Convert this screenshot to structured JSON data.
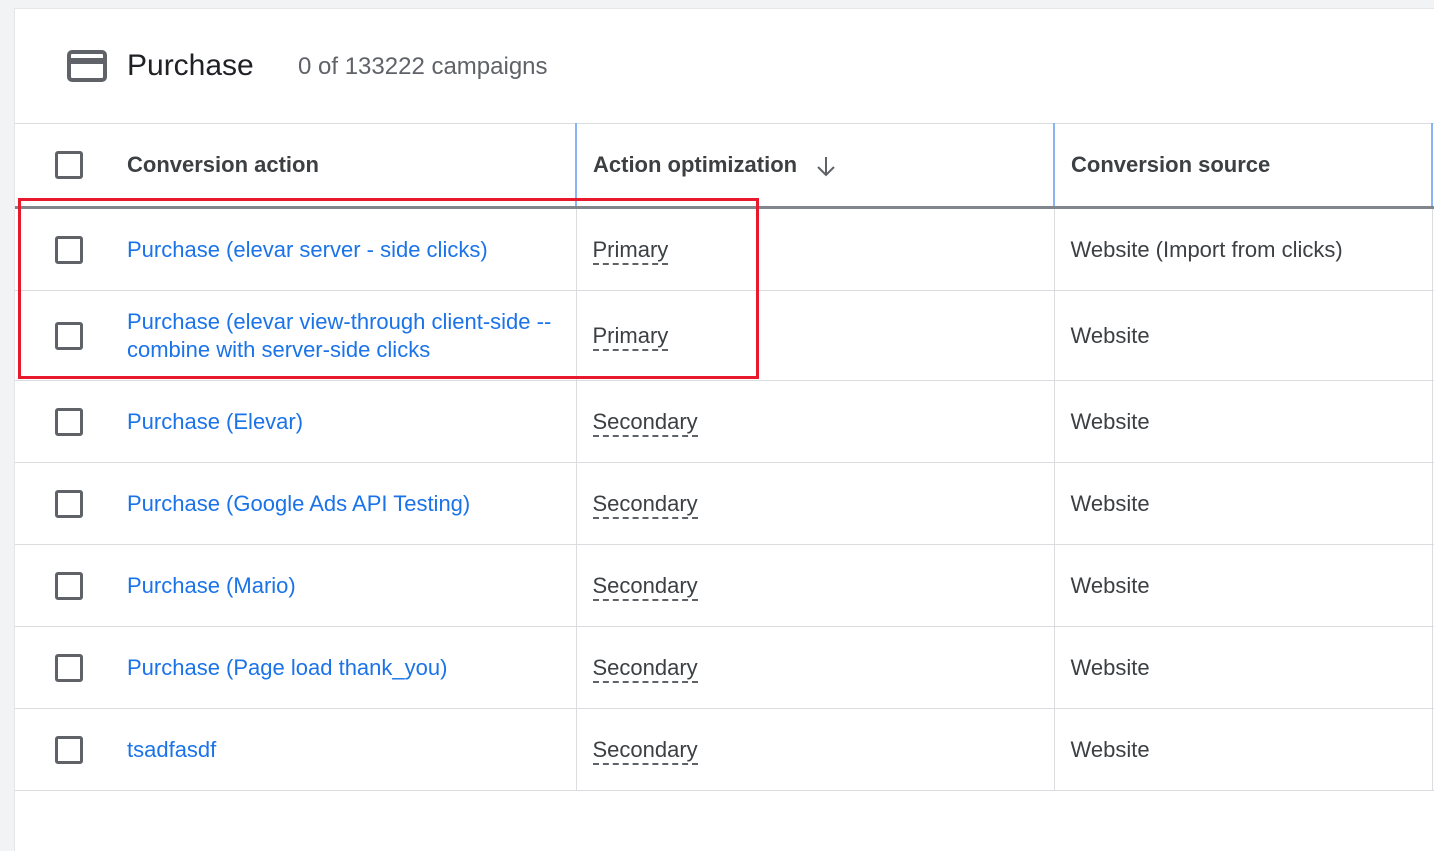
{
  "header": {
    "title": "Purchase",
    "subtitle": "0 of 133222 campaigns"
  },
  "columns": {
    "conversion_action": "Conversion action",
    "action_optimization": "Action optimization",
    "conversion_source": "Conversion source"
  },
  "rows": [
    {
      "name": "Purchase (elevar server - side clicks)",
      "optimization": "Primary",
      "source": "Website (Import from clicks)"
    },
    {
      "name": "Purchase (elevar view-through client-side -- combine with server-side clicks",
      "optimization": "Primary",
      "source": "Website"
    },
    {
      "name": "Purchase (Elevar)",
      "optimization": "Secondary",
      "source": "Website"
    },
    {
      "name": "Purchase (Google Ads API Testing)",
      "optimization": "Secondary",
      "source": "Website"
    },
    {
      "name": "Purchase (Mario)",
      "optimization": "Secondary",
      "source": "Website"
    },
    {
      "name": "Purchase (Page load thank_you)",
      "optimization": "Secondary",
      "source": "Website"
    },
    {
      "name": "tsadfasdf",
      "optimization": "Secondary",
      "source": "Website"
    }
  ],
  "colors": {
    "link": "#1a73e8",
    "highlight": "#e8192c"
  },
  "icons": {
    "header": "credit-card-icon",
    "sort": "arrow-down-icon"
  }
}
